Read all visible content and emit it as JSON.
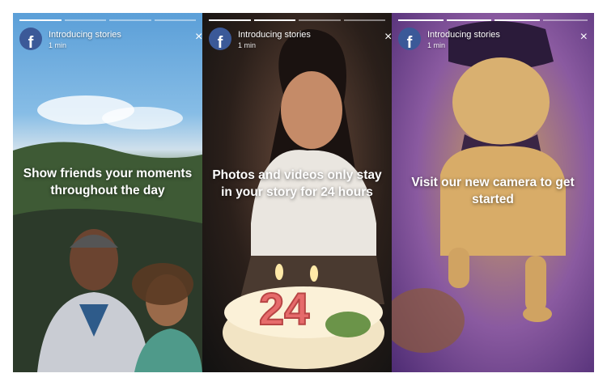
{
  "stories": [
    {
      "title": "Introducing stories",
      "time": "1 min",
      "caption": "Show friends your moments throughout the day",
      "progress_active": 1,
      "progress_total": 4
    },
    {
      "title": "Introducing stories",
      "time": "1 min",
      "caption": "Photos and videos only stay in your story for 24 hours",
      "progress_active": 2,
      "progress_total": 4
    },
    {
      "title": "Introducing stories",
      "time": "1 min",
      "caption": "Visit our new camera to get started",
      "progress_active": 3,
      "progress_total": 4
    }
  ],
  "logo_letter": "f",
  "close_glyph": "×",
  "cake_number": "24",
  "colors": {
    "facebook_blue": "#3b5998",
    "text": "#ffffff"
  }
}
